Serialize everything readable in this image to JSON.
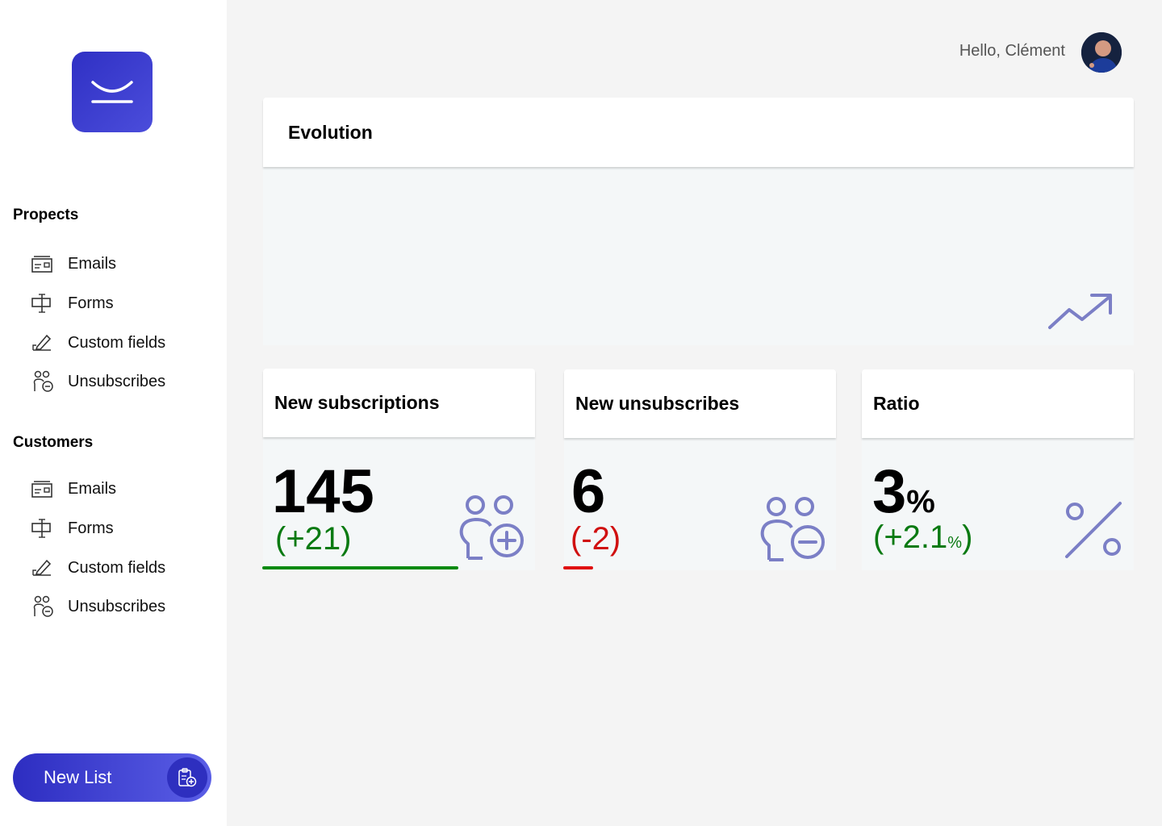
{
  "sidebar": {
    "sections": [
      {
        "title": "Propects",
        "items": [
          {
            "label": "Emails",
            "icon": "email-list-icon"
          },
          {
            "label": "Forms",
            "icon": "form-icon"
          },
          {
            "label": "Custom fields",
            "icon": "edit-field-icon"
          },
          {
            "label": "Unsubscribes",
            "icon": "users-remove-icon"
          }
        ]
      },
      {
        "title": "Customers",
        "items": [
          {
            "label": "Emails",
            "icon": "email-list-icon"
          },
          {
            "label": "Forms",
            "icon": "form-icon"
          },
          {
            "label": "Custom fields",
            "icon": "edit-field-icon"
          },
          {
            "label": "Unsubscribes",
            "icon": "users-remove-icon"
          }
        ]
      }
    ],
    "new_list_label": "New List"
  },
  "header": {
    "greeting": "Hello, Clément"
  },
  "evolution": {
    "title": "Evolution",
    "icon": "trending-up-icon"
  },
  "metrics": [
    {
      "title": "New subscriptions",
      "value": "145",
      "delta": "(+21)",
      "delta_color": "#0a7a12",
      "bar_fraction": 0.72,
      "bar_color": "#0a8a12",
      "icon": "users-add-icon"
    },
    {
      "title": "New unsubscribes",
      "value": "6",
      "delta": "(-2)",
      "delta_color": "#d01010",
      "bar_fraction": 0.11,
      "bar_color": "#e01010",
      "icon": "users-remove-icon"
    },
    {
      "title": "Ratio",
      "value": "3",
      "value_unit": "%",
      "delta_open": "(+2.1",
      "delta_unit": "%",
      "delta_close": ")",
      "delta_color": "#0a7a12",
      "icon": "percent-icon"
    }
  ],
  "colors": {
    "accent": "#2f30c4",
    "icon_tint": "#7b7fc6",
    "positive": "#0a8a12",
    "negative": "#e01010"
  }
}
